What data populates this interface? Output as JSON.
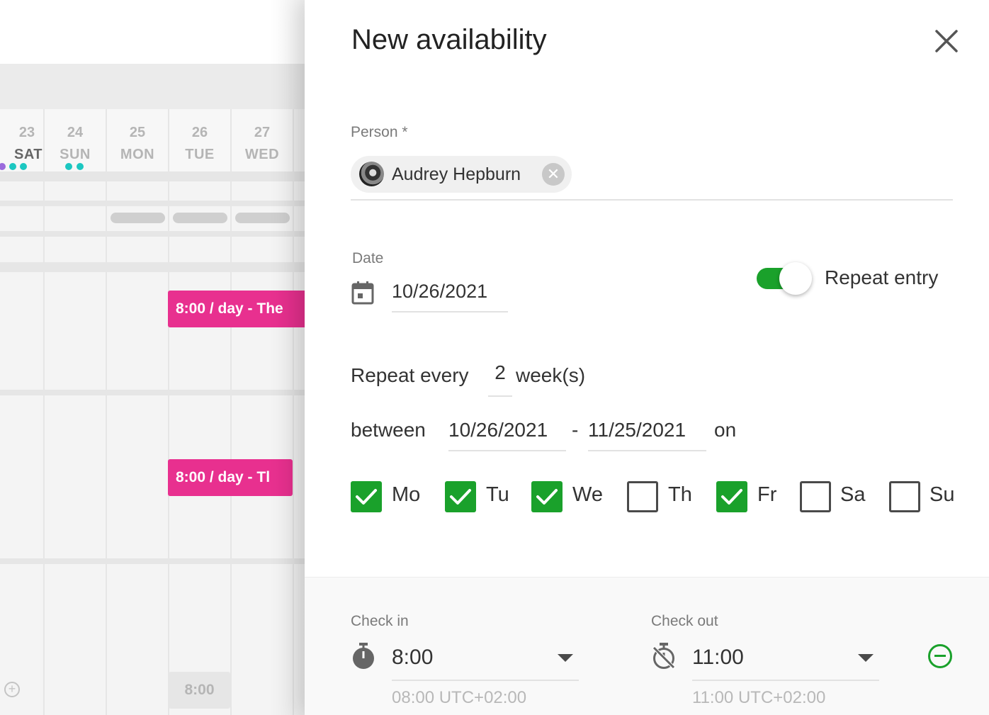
{
  "calendar": {
    "days": [
      {
        "num": "23",
        "dow": "SAT"
      },
      {
        "num": "24",
        "dow": "SUN"
      },
      {
        "num": "25",
        "dow": "MON"
      },
      {
        "num": "26",
        "dow": "TUE"
      },
      {
        "num": "27",
        "dow": "WED"
      }
    ],
    "events": [
      "8:00 / day - The",
      "8:00 / day - Tl"
    ],
    "gray_chip": "8:00",
    "colors": {
      "event": "#e8308f",
      "dot_teal": "#1cc7c1",
      "dot_purple": "#9b6bdc"
    }
  },
  "drawer": {
    "title": "New availability",
    "person": {
      "label": "Person *",
      "name": "Audrey Hepburn"
    },
    "date": {
      "label": "Date",
      "value": "10/26/2021"
    },
    "repeat_toggle": {
      "label": "Repeat entry",
      "on": true
    },
    "repeat": {
      "prefix": "Repeat every",
      "count": "2",
      "unit": "week(s)",
      "between_label": "between",
      "start": "10/26/2021",
      "dash": "-",
      "end": "11/25/2021",
      "on_label": "on"
    },
    "weekdays": [
      {
        "label": "Mo",
        "checked": true
      },
      {
        "label": "Tu",
        "checked": true
      },
      {
        "label": "We",
        "checked": true
      },
      {
        "label": "Th",
        "checked": false
      },
      {
        "label": "Fr",
        "checked": true
      },
      {
        "label": "Sa",
        "checked": false
      },
      {
        "label": "Su",
        "checked": false
      }
    ],
    "check_in": {
      "label": "Check in",
      "value": "8:00",
      "tz": "08:00 UTC+02:00"
    },
    "check_out": {
      "label": "Check out",
      "value": "11:00",
      "tz": "11:00 UTC+02:00"
    },
    "accent_color": "#1aa12b"
  }
}
